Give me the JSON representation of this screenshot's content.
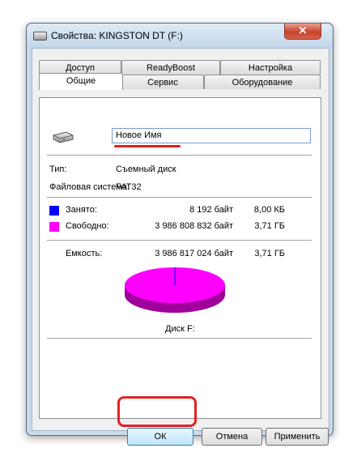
{
  "window": {
    "title": "Свойства: KINGSTON DT (F:)",
    "close_glyph": "✕"
  },
  "tabs": {
    "top_row": [
      "Доступ",
      "ReadyBoost",
      "Настройка"
    ],
    "bottom_row": [
      "Общие",
      "Сервис",
      "Оборудование"
    ],
    "active": "Общие"
  },
  "general": {
    "name_value": "Новое Имя",
    "type_label": "Тип:",
    "type_value": "Съемный диск",
    "fs_label": "Файловая система:",
    "fs_value": "FAT32",
    "used_label": "Занято:",
    "used_bytes": "8 192 байт",
    "used_short": "8,00 КБ",
    "free_label": "Свободно:",
    "free_bytes": "3 986 808 832 байт",
    "free_short": "3,71 ГБ",
    "capacity_label": "Емкость:",
    "capacity_bytes": "3 986 817 024 байт",
    "capacity_short": "3,71 ГБ",
    "disk_label": "Диск F:",
    "used_fraction": 2e-06
  },
  "colors": {
    "used": "#0000ff",
    "free": "#ff00ff",
    "free_dark": "#a0009a",
    "highlight": "#e02020"
  },
  "icons": {
    "drive": "usb-drive-icon"
  },
  "buttons": {
    "ok": "ОК",
    "cancel": "Отмена",
    "apply": "Применить"
  }
}
